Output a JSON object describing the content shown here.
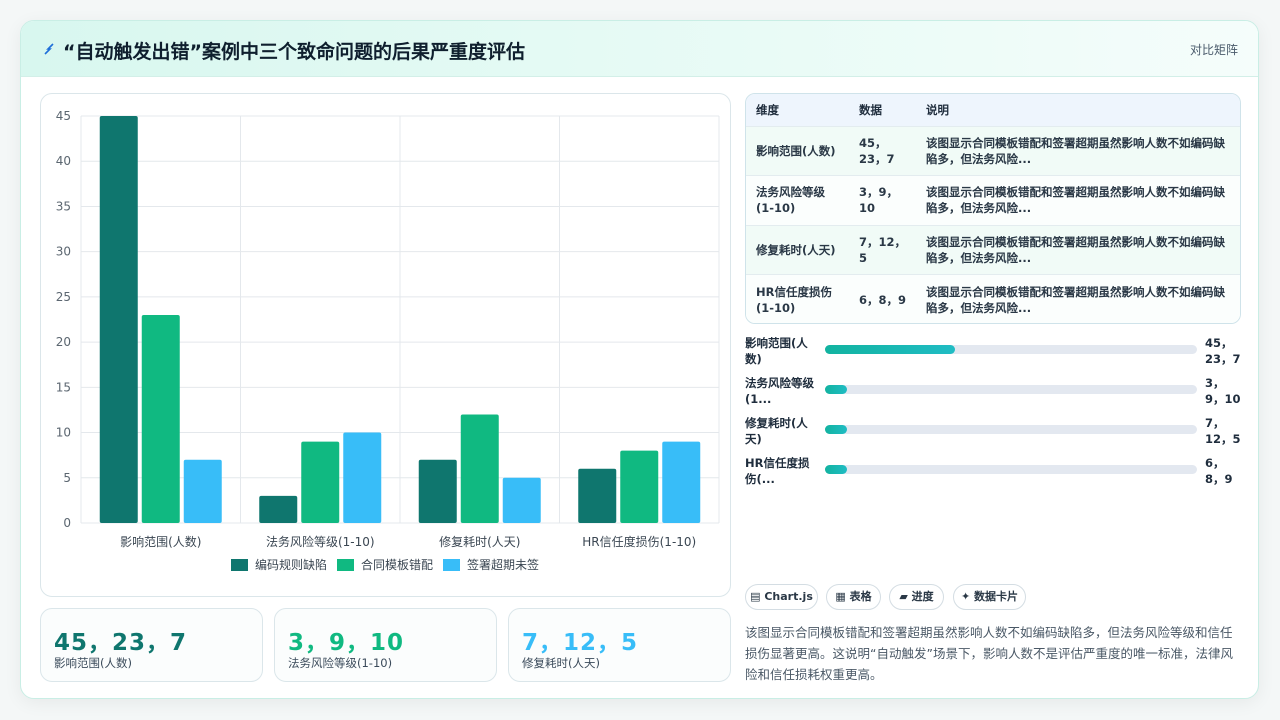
{
  "header": {
    "title": "“自动触发出错”案例中三个致命问题的后果严重度评估",
    "tag": "对比矩阵",
    "icon": "lightning-icon"
  },
  "colors": {
    "series1": "#0f766e",
    "series2": "#10b981",
    "series3": "#38bdf8"
  },
  "chart_data": {
    "type": "bar",
    "categories": [
      "影响范围(人数)",
      "法务风险等级(1-10)",
      "修复耗时(人天)",
      "HR信任度损伤(1-10)"
    ],
    "series": [
      {
        "name": "编码规则缺陷",
        "values": [
          45,
          3,
          7,
          6
        ]
      },
      {
        "name": "合同模板错配",
        "values": [
          23,
          9,
          12,
          8
        ]
      },
      {
        "name": "签署超期未签",
        "values": [
          7,
          10,
          5,
          9
        ]
      }
    ],
    "ylim": [
      0,
      45
    ],
    "yticks": [
      0,
      5,
      10,
      15,
      20,
      25,
      30,
      35,
      40,
      45
    ],
    "grid": true,
    "legend_position": "bottom"
  },
  "stats": [
    {
      "value": "45，23，7",
      "label": "影响范围(人数)"
    },
    {
      "value": "3，9，10",
      "label": "法务风险等级(1-10)"
    },
    {
      "value": "7，12，5",
      "label": "修复耗时(人天)"
    }
  ],
  "table": {
    "headers": [
      "维度",
      "数据",
      "说明"
    ],
    "rows": [
      {
        "dim": "影响范围(人数)",
        "data": "45，23，7",
        "desc": "该图显示合同模板错配和签署超期虽然影响人数不如编码缺陷多，但法务风险..."
      },
      {
        "dim": "法务风险等级(1-10)",
        "data": "3，9，10",
        "desc": "该图显示合同模板错配和签署超期虽然影响人数不如编码缺陷多，但法务风险..."
      },
      {
        "dim": "修复耗时(人天)",
        "data": "7，12，5",
        "desc": "该图显示合同模板错配和签署超期虽然影响人数不如编码缺陷多，但法务风险..."
      },
      {
        "dim": "HR信任度损伤(1-10)",
        "data": "6，8，9",
        "desc": "该图显示合同模板错配和签署超期虽然影响人数不如编码缺陷多，但法务风险..."
      }
    ]
  },
  "progress": [
    {
      "label": "影响范围(人数)",
      "value": "45，23，7",
      "fraction": 0.35
    },
    {
      "label": "法务风险等级(1...",
      "value": "3，9，10",
      "fraction": 0.06
    },
    {
      "label": "修复耗时(人天)",
      "value": "7，12，5",
      "fraction": 0.06
    },
    {
      "label": "HR信任度损伤(...",
      "value": "6，8，9",
      "fraction": 0.06
    }
  ],
  "chips": [
    {
      "label": "Chart.js",
      "icon": "chart-icon"
    },
    {
      "label": "表格",
      "icon": "table-icon"
    },
    {
      "label": "进度",
      "icon": "progress-icon"
    },
    {
      "label": "数据卡片",
      "icon": "sparkle-icon"
    }
  ],
  "summary": "该图显示合同模板错配和签署超期虽然影响人数不如编码缺陷多，但法务风险等级和信任损伤显著更高。这说明“自动触发”场景下，影响人数不是评估严重度的唯一标准，法律风险和信任损耗权重更高。"
}
